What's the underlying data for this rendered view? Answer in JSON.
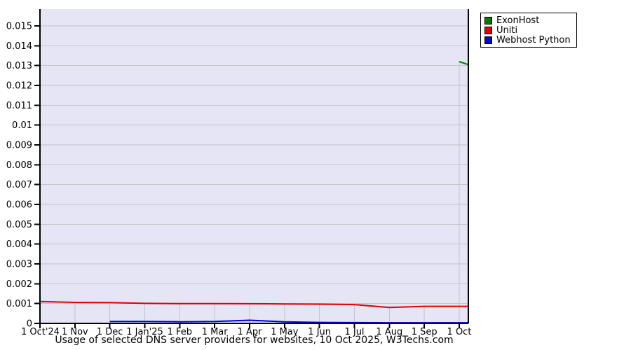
{
  "title": "Usage of selected DNS server providers for websites, 10 Oct 2025, W3Techs.com",
  "source": "W3Techs.com",
  "date_shown": "10 Oct 2025",
  "legend": {
    "position": "top-right",
    "items": [
      {
        "label": "ExonHost",
        "color": "#007a00"
      },
      {
        "label": "Uniti",
        "color": "#e00000"
      },
      {
        "label": "Webhost Python",
        "color": "#0000dd"
      }
    ]
  },
  "chart_data": {
    "type": "line",
    "title": "Usage of selected DNS server providers for websites, 10 Oct 2025, W3Techs.com",
    "xlabel": "",
    "ylabel": "",
    "ylim": [
      0,
      0.015
    ],
    "grid": true,
    "plot_bg": "#e5e5f5",
    "grid_color": "#c4c4c8",
    "legend_position": "top-right",
    "x_ticks": [
      "1 Oct'24",
      "1 Nov",
      "1 Dec",
      "1 Jan'25",
      "1 Feb",
      "1 Mar",
      "1 Apr",
      "1 May",
      "1 Jun",
      "1 Jul",
      "1 Aug",
      "1 Sep",
      "1 Oct"
    ],
    "y_ticks": [
      "0",
      "0.001",
      "0.002",
      "0.003",
      "0.004",
      "0.005",
      "0.006",
      "0.007",
      "0.008",
      "0.009",
      "0.01",
      "0.011",
      "0.012",
      "0.013",
      "0.014",
      "0.015"
    ],
    "series": [
      {
        "name": "ExonHost",
        "color": "#007a00",
        "points": [
          [
            12,
            0.0132
          ],
          [
            12.26,
            0.01305
          ]
        ]
      },
      {
        "name": "Uniti",
        "color": "#e00000",
        "points": [
          [
            0,
            0.0011
          ],
          [
            1,
            0.00106
          ],
          [
            2,
            0.00105
          ],
          [
            3,
            0.00101
          ],
          [
            4,
            0.001
          ],
          [
            5,
            0.001
          ],
          [
            6,
            0.00099
          ],
          [
            7,
            0.00098
          ],
          [
            8,
            0.00097
          ],
          [
            9,
            0.00095
          ],
          [
            10,
            0.0008
          ],
          [
            11,
            0.00086
          ],
          [
            12,
            0.00086
          ],
          [
            12.26,
            0.00086
          ]
        ]
      },
      {
        "name": "Webhost Python",
        "color": "#0000dd",
        "points": [
          [
            2,
            0.0001
          ],
          [
            3,
            0.0001
          ],
          [
            4,
            8e-05
          ],
          [
            5,
            0.0001
          ],
          [
            6,
            0.00016
          ],
          [
            7,
            8e-05
          ],
          [
            8,
            5e-05
          ],
          [
            9,
            4e-05
          ],
          [
            10,
            3e-05
          ],
          [
            11,
            3e-05
          ],
          [
            12,
            3e-05
          ],
          [
            12.26,
            3e-05
          ]
        ]
      }
    ]
  }
}
